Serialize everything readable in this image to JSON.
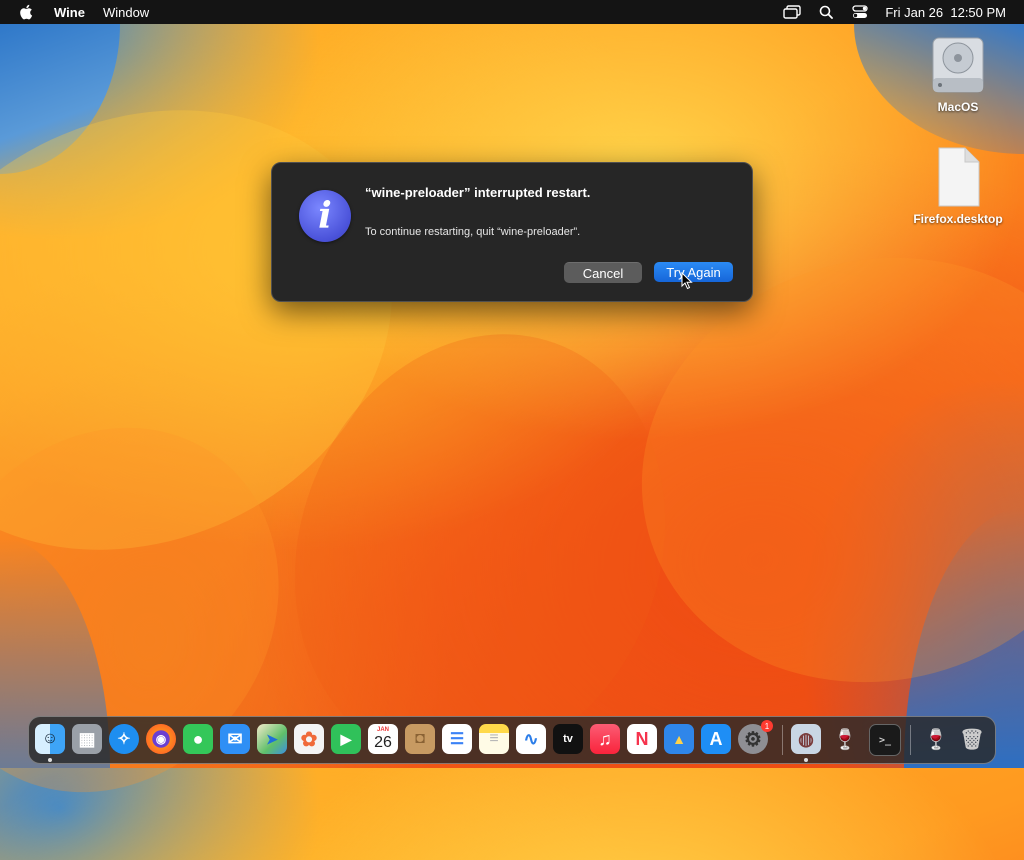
{
  "menubar": {
    "app_name": "Wine",
    "menus": [
      "Window"
    ],
    "datetime": "Fri Jan 26  12:50 PM",
    "icons": [
      "apple-logo",
      "screen-mirroring-icon",
      "spotlight-search-icon",
      "control-center-icon"
    ]
  },
  "desktop": {
    "items": [
      {
        "label": "MacOS",
        "icon": "hard-drive-icon"
      },
      {
        "label": "Firefox.desktop",
        "icon": "document-icon"
      }
    ]
  },
  "dialog": {
    "icon": "info-icon",
    "icon_glyph": "i",
    "title": "“wine-preloader” interrupted restart.",
    "message": "To continue restarting, quit “wine-preloader”.",
    "cancel_label": "Cancel",
    "confirm_label": "Try Again"
  },
  "dock": {
    "apps": [
      {
        "name": "finder",
        "color": "#3ea4f7",
        "glyph": "☺",
        "running": true
      },
      {
        "name": "launchpad",
        "color": "#9aa0a8",
        "glyph": "▦"
      },
      {
        "name": "safari",
        "color": "#1e8ef0",
        "glyph": "✧"
      },
      {
        "name": "firefox",
        "color": "#6a3fd1",
        "glyph": "◉"
      },
      {
        "name": "messages",
        "color": "#34c759",
        "glyph": "●"
      },
      {
        "name": "mail",
        "color": "#2f8ff5",
        "glyph": "✉"
      },
      {
        "name": "maps",
        "color": "#5fbf6a",
        "glyph": "➤"
      },
      {
        "name": "photos",
        "color": "#f4f4f4",
        "glyph": "✿"
      },
      {
        "name": "facetime",
        "color": "#30c15a",
        "glyph": "▶"
      },
      {
        "name": "calendar",
        "color": "#ffffff",
        "glyph": "26",
        "month": "JAN"
      },
      {
        "name": "contacts",
        "color": "#c79a62",
        "glyph": "◘"
      },
      {
        "name": "reminders",
        "color": "#ffffff",
        "glyph": "☰"
      },
      {
        "name": "notes",
        "color": "#ffd94a",
        "glyph": "≡"
      },
      {
        "name": "freeform",
        "color": "#ffffff",
        "glyph": "∿"
      },
      {
        "name": "apple-tv",
        "color": "#111111",
        "glyph": "tv"
      },
      {
        "name": "music",
        "color": "#fa3b51",
        "glyph": "♫"
      },
      {
        "name": "news",
        "color": "#ffffff",
        "glyph": "N"
      },
      {
        "name": "keynote",
        "color": "#2f86ea",
        "glyph": "▲"
      },
      {
        "name": "app-store",
        "color": "#1e8ef5",
        "glyph": "A"
      },
      {
        "name": "system-settings",
        "color": "#8e8e93",
        "glyph": "⚙",
        "badge": "1"
      },
      {
        "name": "wine-installer",
        "color": "#c9d6e4",
        "glyph": "◍",
        "running": true
      },
      {
        "name": "wine",
        "color": "transparent",
        "glyph": "🍷"
      },
      {
        "name": "terminal",
        "color": "#1a1a1a",
        "glyph": ">_"
      },
      {
        "name": "wine-2",
        "color": "transparent",
        "glyph": "🍷"
      },
      {
        "name": "trash",
        "color": "transparent",
        "glyph": "🗑"
      }
    ]
  }
}
